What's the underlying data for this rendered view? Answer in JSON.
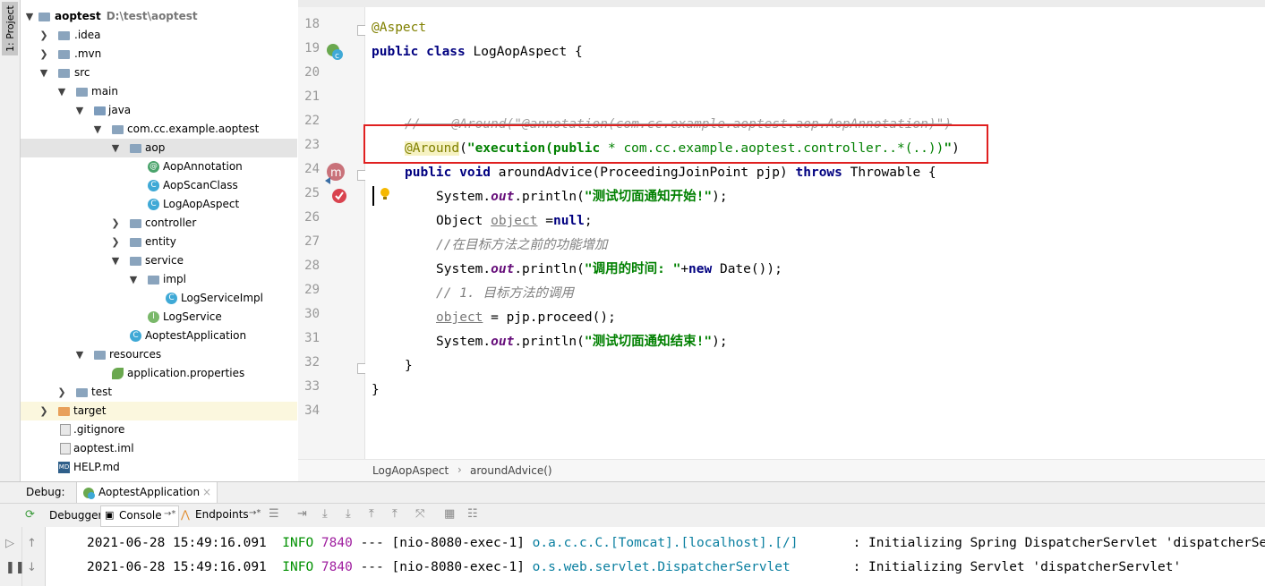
{
  "project_panel": {
    "side_tab": "1: Project",
    "root": {
      "name": "aoptest",
      "path": "D:\\test\\aoptest"
    },
    "nodes": [
      {
        "label": ".idea"
      },
      {
        "label": ".mvn"
      },
      {
        "label": "src"
      },
      {
        "label": "main"
      },
      {
        "label": "java"
      },
      {
        "label": "com.cc.example.aoptest"
      },
      {
        "label": "aop"
      },
      {
        "label": "AopAnnotation"
      },
      {
        "label": "AopScanClass"
      },
      {
        "label": "LogAopAspect"
      },
      {
        "label": "controller"
      },
      {
        "label": "entity"
      },
      {
        "label": "service"
      },
      {
        "label": "impl"
      },
      {
        "label": "LogServiceImpl"
      },
      {
        "label": "LogService"
      },
      {
        "label": "AoptestApplication"
      },
      {
        "label": "resources"
      },
      {
        "label": "application.properties"
      },
      {
        "label": "test"
      },
      {
        "label": "target"
      },
      {
        "label": ".gitignore"
      },
      {
        "label": "aoptest.iml"
      },
      {
        "label": "HELP.md"
      }
    ]
  },
  "editor": {
    "line_numbers": [
      "18",
      "19",
      "20",
      "21",
      "22",
      "23",
      "24",
      "25",
      "26",
      "27",
      "28",
      "29",
      "30",
      "31",
      "32",
      "33",
      "34"
    ],
    "code": {
      "l18": "@Aspect",
      "l19_kw": "public class ",
      "l19_name": "LogAopAspect {",
      "l22": "//    @Around(\"@annotation(com.cc.example.aoptest.aop.AopAnnotation)\")",
      "l23_ann": "@Around",
      "l23_open": "(",
      "l23_str1": "\"execution(public",
      "l23_mid": " * com.cc.example.aoptest.controller..*(..))",
      "l23_str2": "\"",
      "l23_close": ")",
      "l24_kw": "public void ",
      "l24_mid": "aroundAdvice(ProceedingJoinPoint pjp) ",
      "l24_kw2": "throws ",
      "l24_end": "Throwable {",
      "sys": "System.",
      "out": "out",
      "println": ".println(",
      "l25_str": "\"测试切面通知开始!\"",
      "end_paren": ");",
      "l26_a": "Object ",
      "l26_var": "object",
      "l26_b": " =",
      "l26_null": "null",
      "l26_c": ";",
      "l27": "//在目标方法之前的功能增加",
      "l28_str": "\"调用的时间: \"",
      "l28_plus": "+",
      "l28_new": "new ",
      "l28_end": "Date());",
      "l29": "// 1. 目标方法的调用",
      "l30_var": "object",
      "l30_end": " = pjp.proceed();",
      "l31_str": "\"测试切面通知结束!\"",
      "l32": "}",
      "l33": "}"
    },
    "breadcrumb": [
      "LogAopAspect",
      "aroundAdvice()"
    ]
  },
  "debug": {
    "label": "Debug:",
    "session_tab": "AoptestApplication",
    "tabs": [
      "Debugger",
      "Console",
      "Endpoints"
    ],
    "log_lines": [
      {
        "time": "2021-06-28 15:49:16.091",
        "level": "INFO",
        "pid": "7840",
        "sep": "---",
        "thread": "[nio-8080-exec-1]",
        "logger": "o.a.c.c.C.[Tomcat].[localhost].[/]",
        "message": ": Initializing Spring DispatcherServlet 'dispatcherServlet'"
      },
      {
        "time": "2021-06-28 15:49:16.091",
        "level": "INFO",
        "pid": "7840",
        "sep": "---",
        "thread": "[nio-8080-exec-1]",
        "logger": "o.s.web.servlet.DispatcherServlet",
        "message": ": Initializing Servlet 'dispatcherServlet'"
      }
    ]
  }
}
